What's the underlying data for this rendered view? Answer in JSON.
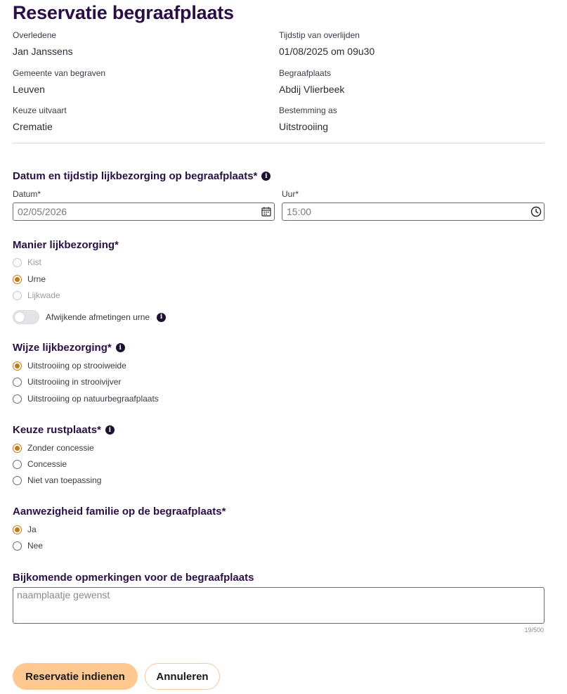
{
  "page": {
    "title": "Reservatie begraafplaats"
  },
  "summary": {
    "overledene_label": "Overledene",
    "overledene_value": "Jan Janssens",
    "tijdstip_label": "Tijdstip van overlijden",
    "tijdstip_value": "01/08/2025 om 09u30",
    "gemeente_label": "Gemeente van begraven",
    "gemeente_value": "Leuven",
    "begraafplaats_label": "Begraafplaats",
    "begraafplaats_value": "Abdij Vlierbeek",
    "uitvaart_label": "Keuze uitvaart",
    "uitvaart_value": "Crematie",
    "bestemming_label": "Bestemming as",
    "bestemming_value": "Uitstrooiing"
  },
  "datetime": {
    "heading": "Datum en tijdstip lijkbezorging op begraafplaats*",
    "date_label": "Datum*",
    "date_value": "02/05/2026",
    "time_label": "Uur*",
    "time_value": "15:00"
  },
  "manier": {
    "heading": "Manier lijkbezorging*",
    "options": [
      "Kist",
      "Urne",
      "Lijkwade"
    ],
    "selected": "Urne",
    "toggle_label": "Afwijkende afmetingen urne"
  },
  "wijze": {
    "heading": "Wijze lijkbezorging*",
    "options": [
      "Uitstrooiing op strooiweide",
      "Uitstrooiing in strooivijver",
      "Uitstrooiing op natuurbegraafplaats"
    ],
    "selected": "Uitstrooiing op strooiweide"
  },
  "rustplaats": {
    "heading": "Keuze rustplaats*",
    "options": [
      "Zonder concessie",
      "Concessie",
      "Niet van toepassing"
    ],
    "selected": "Zonder concessie"
  },
  "familie": {
    "heading": "Aanwezigheid familie op de begraafplaats*",
    "options": [
      "Ja",
      "Nee"
    ],
    "selected": "Ja"
  },
  "opmerkingen": {
    "heading": "Bijkomende opmerkingen voor de begraafplaats",
    "value": "naamplaatje gewenst",
    "counter": "19/500"
  },
  "actions": {
    "submit_label": "Reservatie indienen",
    "cancel_label": "Annuleren"
  },
  "colors": {
    "accent": "#c27a16",
    "heading": "#2a0f45",
    "primary_button": "#ffc890"
  }
}
